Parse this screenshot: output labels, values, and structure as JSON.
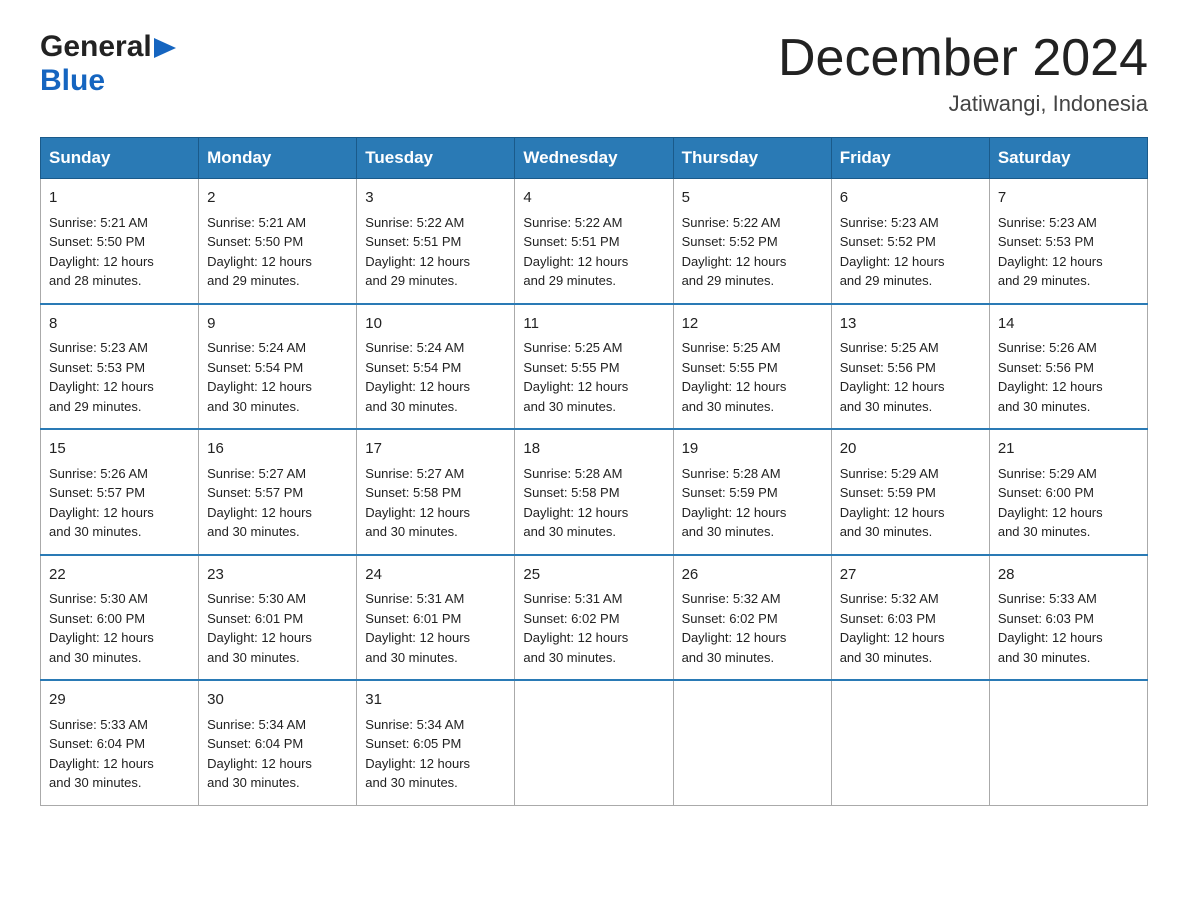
{
  "logo": {
    "general": "General",
    "blue": "Blue"
  },
  "title": "December 2024",
  "location": "Jatiwangi, Indonesia",
  "days_of_week": [
    "Sunday",
    "Monday",
    "Tuesday",
    "Wednesday",
    "Thursday",
    "Friday",
    "Saturday"
  ],
  "weeks": [
    [
      {
        "day": "1",
        "sunrise": "5:21 AM",
        "sunset": "5:50 PM",
        "daylight": "12 hours and 28 minutes."
      },
      {
        "day": "2",
        "sunrise": "5:21 AM",
        "sunset": "5:50 PM",
        "daylight": "12 hours and 29 minutes."
      },
      {
        "day": "3",
        "sunrise": "5:22 AM",
        "sunset": "5:51 PM",
        "daylight": "12 hours and 29 minutes."
      },
      {
        "day": "4",
        "sunrise": "5:22 AM",
        "sunset": "5:51 PM",
        "daylight": "12 hours and 29 minutes."
      },
      {
        "day": "5",
        "sunrise": "5:22 AM",
        "sunset": "5:52 PM",
        "daylight": "12 hours and 29 minutes."
      },
      {
        "day": "6",
        "sunrise": "5:23 AM",
        "sunset": "5:52 PM",
        "daylight": "12 hours and 29 minutes."
      },
      {
        "day": "7",
        "sunrise": "5:23 AM",
        "sunset": "5:53 PM",
        "daylight": "12 hours and 29 minutes."
      }
    ],
    [
      {
        "day": "8",
        "sunrise": "5:23 AM",
        "sunset": "5:53 PM",
        "daylight": "12 hours and 29 minutes."
      },
      {
        "day": "9",
        "sunrise": "5:24 AM",
        "sunset": "5:54 PM",
        "daylight": "12 hours and 30 minutes."
      },
      {
        "day": "10",
        "sunrise": "5:24 AM",
        "sunset": "5:54 PM",
        "daylight": "12 hours and 30 minutes."
      },
      {
        "day": "11",
        "sunrise": "5:25 AM",
        "sunset": "5:55 PM",
        "daylight": "12 hours and 30 minutes."
      },
      {
        "day": "12",
        "sunrise": "5:25 AM",
        "sunset": "5:55 PM",
        "daylight": "12 hours and 30 minutes."
      },
      {
        "day": "13",
        "sunrise": "5:25 AM",
        "sunset": "5:56 PM",
        "daylight": "12 hours and 30 minutes."
      },
      {
        "day": "14",
        "sunrise": "5:26 AM",
        "sunset": "5:56 PM",
        "daylight": "12 hours and 30 minutes."
      }
    ],
    [
      {
        "day": "15",
        "sunrise": "5:26 AM",
        "sunset": "5:57 PM",
        "daylight": "12 hours and 30 minutes."
      },
      {
        "day": "16",
        "sunrise": "5:27 AM",
        "sunset": "5:57 PM",
        "daylight": "12 hours and 30 minutes."
      },
      {
        "day": "17",
        "sunrise": "5:27 AM",
        "sunset": "5:58 PM",
        "daylight": "12 hours and 30 minutes."
      },
      {
        "day": "18",
        "sunrise": "5:28 AM",
        "sunset": "5:58 PM",
        "daylight": "12 hours and 30 minutes."
      },
      {
        "day": "19",
        "sunrise": "5:28 AM",
        "sunset": "5:59 PM",
        "daylight": "12 hours and 30 minutes."
      },
      {
        "day": "20",
        "sunrise": "5:29 AM",
        "sunset": "5:59 PM",
        "daylight": "12 hours and 30 minutes."
      },
      {
        "day": "21",
        "sunrise": "5:29 AM",
        "sunset": "6:00 PM",
        "daylight": "12 hours and 30 minutes."
      }
    ],
    [
      {
        "day": "22",
        "sunrise": "5:30 AM",
        "sunset": "6:00 PM",
        "daylight": "12 hours and 30 minutes."
      },
      {
        "day": "23",
        "sunrise": "5:30 AM",
        "sunset": "6:01 PM",
        "daylight": "12 hours and 30 minutes."
      },
      {
        "day": "24",
        "sunrise": "5:31 AM",
        "sunset": "6:01 PM",
        "daylight": "12 hours and 30 minutes."
      },
      {
        "day": "25",
        "sunrise": "5:31 AM",
        "sunset": "6:02 PM",
        "daylight": "12 hours and 30 minutes."
      },
      {
        "day": "26",
        "sunrise": "5:32 AM",
        "sunset": "6:02 PM",
        "daylight": "12 hours and 30 minutes."
      },
      {
        "day": "27",
        "sunrise": "5:32 AM",
        "sunset": "6:03 PM",
        "daylight": "12 hours and 30 minutes."
      },
      {
        "day": "28",
        "sunrise": "5:33 AM",
        "sunset": "6:03 PM",
        "daylight": "12 hours and 30 minutes."
      }
    ],
    [
      {
        "day": "29",
        "sunrise": "5:33 AM",
        "sunset": "6:04 PM",
        "daylight": "12 hours and 30 minutes."
      },
      {
        "day": "30",
        "sunrise": "5:34 AM",
        "sunset": "6:04 PM",
        "daylight": "12 hours and 30 minutes."
      },
      {
        "day": "31",
        "sunrise": "5:34 AM",
        "sunset": "6:05 PM",
        "daylight": "12 hours and 30 minutes."
      },
      null,
      null,
      null,
      null
    ]
  ],
  "labels": {
    "sunrise_prefix": "Sunrise: ",
    "sunset_prefix": "Sunset: ",
    "daylight_prefix": "Daylight: "
  }
}
